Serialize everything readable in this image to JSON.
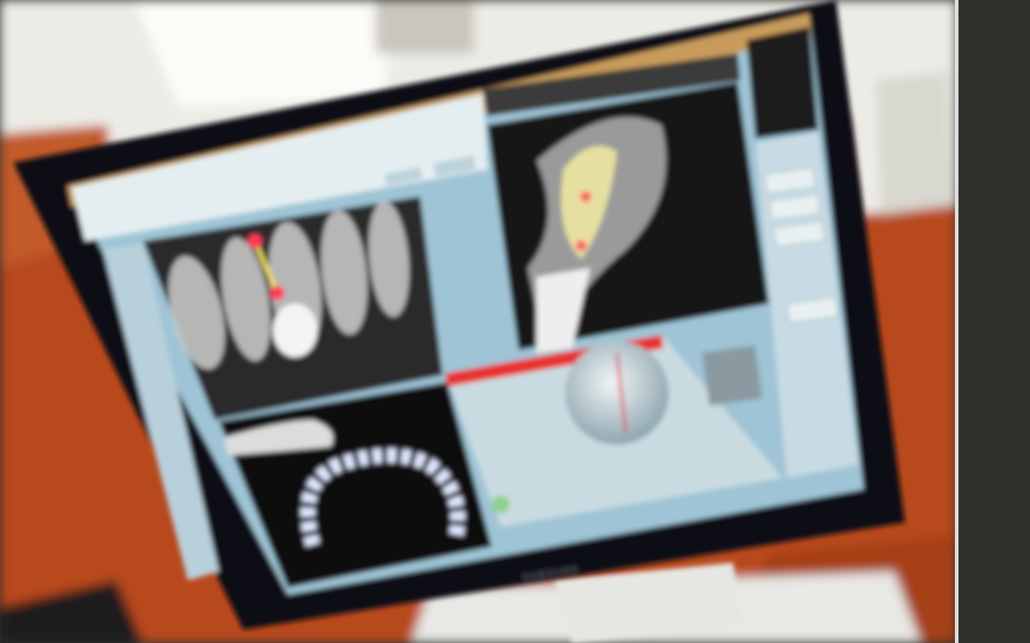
{
  "photo": {
    "subject": "monitor-displaying-dental-imaging-software",
    "monitor_brand": "SAMSUNG"
  },
  "colors": {
    "wall": "#b84a1c",
    "window_light": "#f2f2ee",
    "bezel": "#101015",
    "screen_bg": "#9fc4d6",
    "xray_marker": "#ff3a5a",
    "panel_header": "#e8332f",
    "right_strip": "#2f302c"
  }
}
